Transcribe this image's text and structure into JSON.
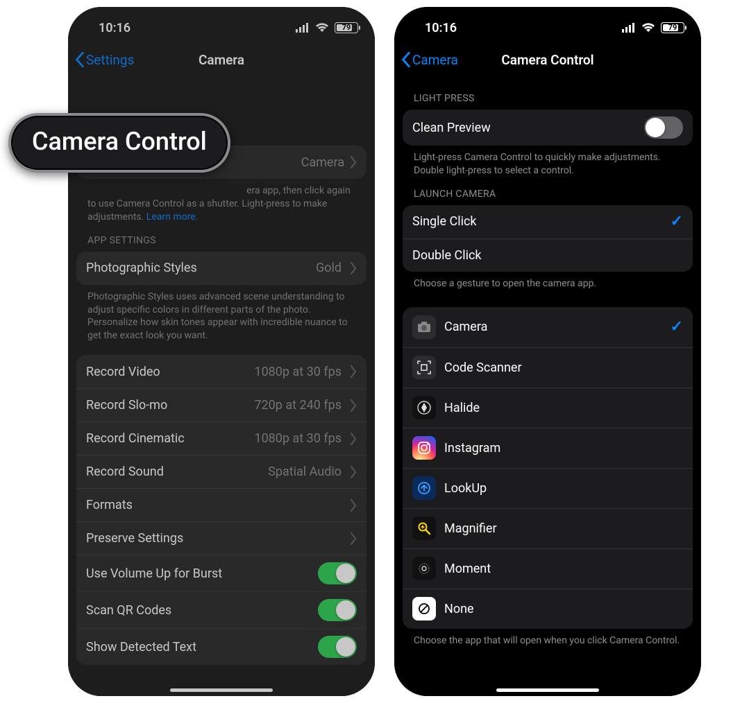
{
  "status": {
    "time": "10:16",
    "battery_pct": 79,
    "battery_text": "79"
  },
  "callout": "Camera Control",
  "left": {
    "back_label": "Settings",
    "title": "Camera",
    "camera_control_row": {
      "value": "Camera"
    },
    "cc_footer_pre": "again to use Camera Control as a shutter. Light-press to make adjustments. ",
    "cc_footer_visible_top": "era app, then click",
    "cc_footer_link": "Learn more.",
    "app_settings_header": "APP SETTINGS",
    "photographic": {
      "label": "Photographic Styles",
      "value": "Gold"
    },
    "photo_footer": "Photographic Styles uses advanced scene understanding to adjust specific colors in different parts of the photo. Personalize how skin tones appear with incredible nuance to get the exact look you want.",
    "rows": [
      {
        "label": "Record Video",
        "value": "1080p at 30 fps",
        "type": "nav"
      },
      {
        "label": "Record Slo-mo",
        "value": "720p at 240 fps",
        "type": "nav"
      },
      {
        "label": "Record Cinematic",
        "value": "1080p at 30 fps",
        "type": "nav"
      },
      {
        "label": "Record Sound",
        "value": "Spatial Audio",
        "type": "nav"
      },
      {
        "label": "Formats",
        "value": "",
        "type": "nav"
      },
      {
        "label": "Preserve Settings",
        "value": "",
        "type": "nav"
      },
      {
        "label": "Use Volume Up for Burst",
        "type": "toggle",
        "on": true
      },
      {
        "label": "Scan QR Codes",
        "type": "toggle",
        "on": true
      },
      {
        "label": "Show Detected Text",
        "type": "toggle",
        "on": true
      }
    ]
  },
  "right": {
    "back_label": "Camera",
    "title": "Camera Control",
    "light_press_header": "LIGHT PRESS",
    "clean_preview_label": "Clean Preview",
    "clean_preview_on": false,
    "light_press_footer": "Light-press Camera Control to quickly make adjustments. Double light-press to select a control.",
    "launch_header": "LAUNCH CAMERA",
    "launch_options": [
      {
        "label": "Single Click",
        "selected": true
      },
      {
        "label": "Double Click",
        "selected": false
      }
    ],
    "launch_footer": "Choose a gesture to open the camera app.",
    "apps": [
      {
        "label": "Camera",
        "selected": true,
        "icon": "camera"
      },
      {
        "label": "Code Scanner",
        "selected": false,
        "icon": "qr"
      },
      {
        "label": "Halide",
        "selected": false,
        "icon": "halide"
      },
      {
        "label": "Instagram",
        "selected": false,
        "icon": "instagram"
      },
      {
        "label": "LookUp",
        "selected": false,
        "icon": "lookup"
      },
      {
        "label": "Magnifier",
        "selected": false,
        "icon": "magnifier"
      },
      {
        "label": "Moment",
        "selected": false,
        "icon": "moment"
      },
      {
        "label": "None",
        "selected": false,
        "icon": "none"
      }
    ],
    "apps_footer": "Choose the app that will open when you click Camera Control."
  }
}
